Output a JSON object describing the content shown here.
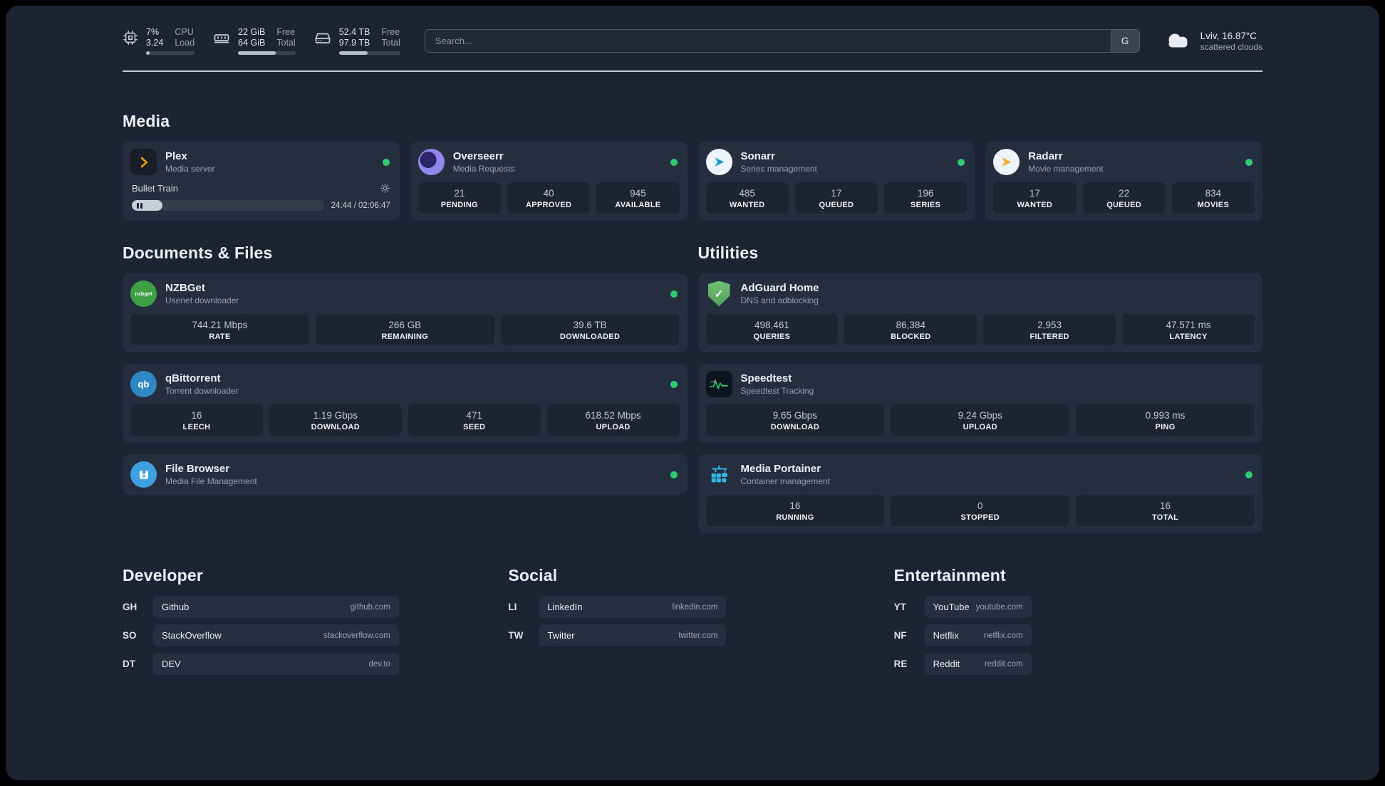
{
  "colors": {
    "background": "#1b2433",
    "card": "#252e3e",
    "status_online": "#2ecc71",
    "plex_amber": "#e5a00d",
    "adguard_green": "#5fae68",
    "speedtest_green": "#2ecc71",
    "portainer_blue": "#35b9e9"
  },
  "topbar": {
    "cpu": {
      "icon": "cpu-icon",
      "values": [
        "7%",
        "3.24"
      ],
      "labels": [
        "CPU",
        "Load"
      ],
      "usage_pct": 7
    },
    "memory": {
      "icon": "memory-icon",
      "values": [
        "22 GiB",
        "64 GiB"
      ],
      "labels": [
        "Free",
        "Total"
      ],
      "usage_pct": 66
    },
    "disk": {
      "icon": "disk-icon",
      "values": [
        "52.4 TB",
        "97.9 TB"
      ],
      "labels": [
        "Free",
        "Total"
      ],
      "usage_pct": 47
    },
    "search": {
      "placeholder": "Search...",
      "provider_button": "G"
    },
    "weather": {
      "icon": "cloud-icon",
      "location": "Lviv, 16.87°C",
      "condition": "scattered clouds"
    }
  },
  "media": {
    "title": "Media",
    "services": [
      {
        "name": "Plex",
        "subtitle": "Media server",
        "status": "online",
        "now_playing": {
          "title": "Bullet Train",
          "time_display": "24:44 / 02:06:47",
          "progress_pct": 16
        }
      },
      {
        "name": "Overseerr",
        "subtitle": "Media Requests",
        "status": "online",
        "stats": [
          {
            "value": "21",
            "label": "PENDING"
          },
          {
            "value": "40",
            "label": "APPROVED"
          },
          {
            "value": "945",
            "label": "AVAILABLE"
          }
        ]
      },
      {
        "name": "Sonarr",
        "subtitle": "Series management",
        "status": "online",
        "stats": [
          {
            "value": "485",
            "label": "WANTED"
          },
          {
            "value": "17",
            "label": "QUEUED"
          },
          {
            "value": "196",
            "label": "SERIES"
          }
        ]
      },
      {
        "name": "Radarr",
        "subtitle": "Movie management",
        "status": "online",
        "stats": [
          {
            "value": "17",
            "label": "WANTED"
          },
          {
            "value": "22",
            "label": "QUEUED"
          },
          {
            "value": "834",
            "label": "MOVIES"
          }
        ]
      }
    ]
  },
  "documents": {
    "title": "Documents & Files",
    "services": [
      {
        "name": "NZBGet",
        "subtitle": "Usenet downloader",
        "status": "online",
        "icon_text": "nzbget",
        "stats": [
          {
            "value": "744.21 Mbps",
            "label": "RATE"
          },
          {
            "value": "266 GB",
            "label": "REMAINING"
          },
          {
            "value": "39.6 TB",
            "label": "DOWNLOADED"
          }
        ]
      },
      {
        "name": "qBittorrent",
        "subtitle": "Torrent downloader",
        "status": "online",
        "icon_text": "qb",
        "stats": [
          {
            "value": "16",
            "label": "LEECH"
          },
          {
            "value": "1.19 Gbps",
            "label": "DOWNLOAD"
          },
          {
            "value": "471",
            "label": "SEED"
          },
          {
            "value": "618.52 Mbps",
            "label": "UPLOAD"
          }
        ]
      },
      {
        "name": "File Browser",
        "subtitle": "Media File Management",
        "status": "online"
      }
    ]
  },
  "utilities": {
    "title": "Utilities",
    "services": [
      {
        "name": "AdGuard Home",
        "subtitle": "DNS and adblocking",
        "icon_text": "✓",
        "stats": [
          {
            "value": "498,461",
            "label": "QUERIES"
          },
          {
            "value": "86,384",
            "label": "BLOCKED"
          },
          {
            "value": "2,953",
            "label": "FILTERED"
          },
          {
            "value": "47.571 ms",
            "label": "LATENCY"
          }
        ]
      },
      {
        "name": "Speedtest",
        "subtitle": "Speedtest Tracking",
        "stats": [
          {
            "value": "9.65 Gbps",
            "label": "DOWNLOAD"
          },
          {
            "value": "9.24 Gbps",
            "label": "UPLOAD"
          },
          {
            "value": "0.993 ms",
            "label": "PING"
          }
        ]
      },
      {
        "name": "Media Portainer",
        "subtitle": "Container management",
        "status": "online",
        "stats": [
          {
            "value": "16",
            "label": "RUNNING"
          },
          {
            "value": "0",
            "label": "STOPPED"
          },
          {
            "value": "16",
            "label": "TOTAL"
          }
        ]
      }
    ]
  },
  "bookmarks": {
    "groups": [
      {
        "title": "Developer",
        "items": [
          {
            "abbr": "GH",
            "name": "Github",
            "url": "github.com"
          },
          {
            "abbr": "SO",
            "name": "StackOverflow",
            "url": "stackoverflow.com"
          },
          {
            "abbr": "DT",
            "name": "DEV",
            "url": "dev.to"
          }
        ]
      },
      {
        "title": "Social",
        "items": [
          {
            "abbr": "LI",
            "name": "LinkedIn",
            "url": "linkedin.com"
          },
          {
            "abbr": "TW",
            "name": "Twitter",
            "url": "twitter.com"
          }
        ]
      },
      {
        "title": "Entertainment",
        "items": [
          {
            "abbr": "YT",
            "name": "YouTube",
            "url": "youtube.com"
          },
          {
            "abbr": "NF",
            "name": "Netflix",
            "url": "netflix.com"
          },
          {
            "abbr": "RE",
            "name": "Reddit",
            "url": "reddit.com"
          }
        ]
      }
    ]
  }
}
